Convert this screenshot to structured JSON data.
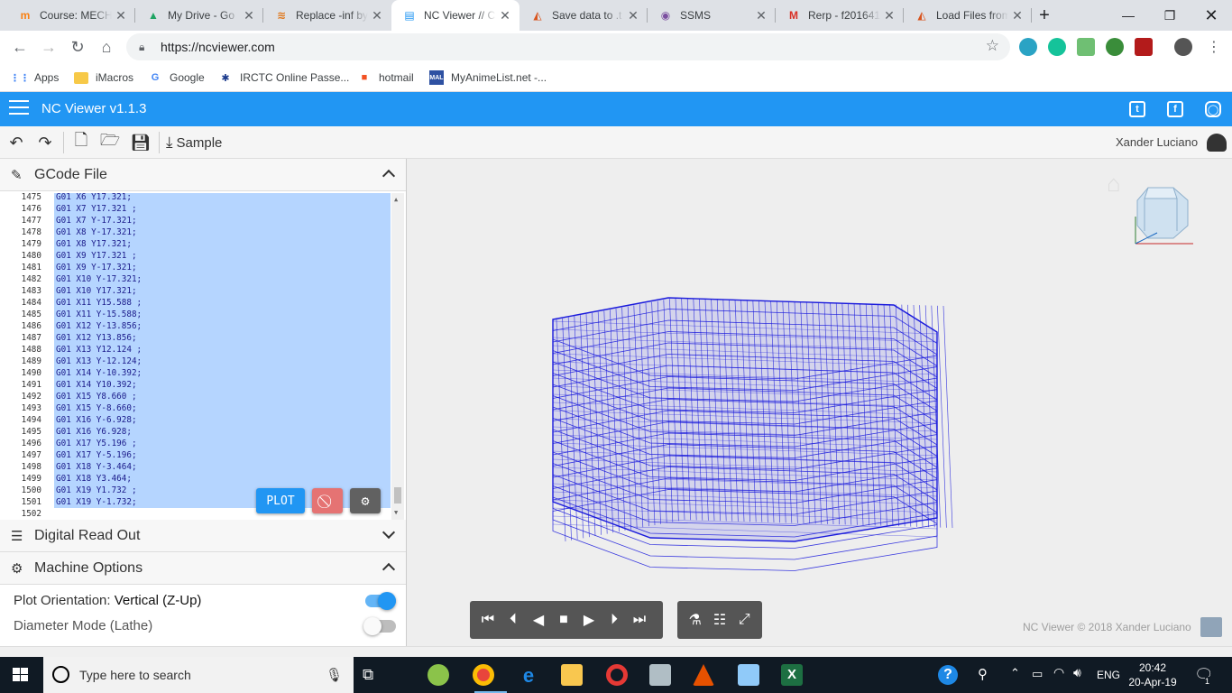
{
  "browser": {
    "tabs": [
      {
        "title": "Course: MECH",
        "favicon": "moodle-icon",
        "color": "#f98012",
        "glyph": "m"
      },
      {
        "title": "My Drive - Go",
        "favicon": "drive-icon",
        "color": "#1fa463",
        "glyph": "▲"
      },
      {
        "title": "Replace -inf by",
        "favicon": "stackexchange-icon",
        "color": "#e0781c",
        "glyph": "≋"
      },
      {
        "title": "NC Viewer // C",
        "favicon": "ncviewer-icon",
        "color": "#2196f3",
        "glyph": "▤"
      },
      {
        "title": "Save data to .t",
        "favicon": "matlab-icon",
        "color": "#d9541e",
        "glyph": "◭"
      },
      {
        "title": "SSMS",
        "favicon": "ssms-icon",
        "color": "#7b4fa0",
        "glyph": "◉"
      },
      {
        "title": "Rerp - f201641",
        "favicon": "gmail-icon",
        "color": "#d93025",
        "glyph": "M"
      },
      {
        "title": "Load Files from",
        "favicon": "matlab-icon",
        "color": "#d9541e",
        "glyph": "◭"
      }
    ],
    "active_tab": 3,
    "new_tab": "+",
    "url": "https://ncviewer.com",
    "bookmarks": [
      {
        "label": "Apps",
        "icon": "apps-grid-icon",
        "color": "#4285f4",
        "glyph": "⋮⋮"
      },
      {
        "label": "iMacros",
        "icon": "folder-icon",
        "color": "#f7c948",
        "glyph": ""
      },
      {
        "label": "Google",
        "icon": "google-icon",
        "color": "#4285f4",
        "glyph": "G"
      },
      {
        "label": "IRCTC Online Passe...",
        "icon": "irctc-icon",
        "color": "#1b3a8c",
        "glyph": "✱"
      },
      {
        "label": "hotmail",
        "icon": "microsoft-icon",
        "color": "#f25022",
        "glyph": "■"
      },
      {
        "label": "MyAnimeList.net -...",
        "icon": "mal-icon",
        "color": "#2e51a2",
        "glyph": "MAL"
      }
    ]
  },
  "app": {
    "title": "NC Viewer  v1.1.3",
    "sample_label": "Sample",
    "user_name": "Xander Luciano",
    "gcode_header": "GCode File",
    "gcode_lines": [
      {
        "n": "1475",
        "code": "G01 X6 Y17.321;"
      },
      {
        "n": "1476",
        "code": "G01 X7 Y17.321 ;"
      },
      {
        "n": "1477",
        "code": "G01 X7 Y-17.321;"
      },
      {
        "n": "1478",
        "code": "G01 X8 Y-17.321;"
      },
      {
        "n": "1479",
        "code": "G01 X8 Y17.321;"
      },
      {
        "n": "1480",
        "code": "G01 X9 Y17.321 ;"
      },
      {
        "n": "1481",
        "code": "G01 X9 Y-17.321;"
      },
      {
        "n": "1482",
        "code": "G01 X10 Y-17.321;"
      },
      {
        "n": "1483",
        "code": "G01 X10 Y17.321;"
      },
      {
        "n": "1484",
        "code": "G01 X11 Y15.588 ;"
      },
      {
        "n": "1485",
        "code": "G01 X11 Y-15.588;"
      },
      {
        "n": "1486",
        "code": "G01 X12 Y-13.856;"
      },
      {
        "n": "1487",
        "code": "G01 X12 Y13.856;"
      },
      {
        "n": "1488",
        "code": "G01 X13 Y12.124 ;"
      },
      {
        "n": "1489",
        "code": "G01 X13 Y-12.124;"
      },
      {
        "n": "1490",
        "code": "G01 X14 Y-10.392;"
      },
      {
        "n": "1491",
        "code": "G01 X14 Y10.392;"
      },
      {
        "n": "1492",
        "code": "G01 X15 Y8.660 ;"
      },
      {
        "n": "1493",
        "code": "G01 X15 Y-8.660;"
      },
      {
        "n": "1494",
        "code": "G01 X16 Y-6.928;"
      },
      {
        "n": "1495",
        "code": "G01 X16 Y6.928;"
      },
      {
        "n": "1496",
        "code": "G01 X17 Y5.196 ;"
      },
      {
        "n": "1497",
        "code": "G01 X17 Y-5.196;"
      },
      {
        "n": "1498",
        "code": "G01 X18 Y-3.464;"
      },
      {
        "n": "1499",
        "code": "G01 X18 Y3.464;"
      },
      {
        "n": "1500",
        "code": "G01 X19 Y1.732 ;"
      },
      {
        "n": "1501",
        "code": "G01 X19 Y-1.732;"
      },
      {
        "n": "1502",
        "code": ""
      }
    ],
    "plot_label": "PLOT",
    "dro_header": "Digital Read Out",
    "machine_header": "Machine Options",
    "plot_orientation_label": "Plot Orientation:",
    "plot_orientation_value": "Vertical (Z-Up)",
    "plot_orientation_on": true,
    "diameter_mode_label": "Diameter Mode (Lathe)",
    "diameter_mode_on": false,
    "footer_credit": "NC Viewer © 2018 Xander Luciano",
    "accent": "#2196f3",
    "toolpath_color": "#1a1adc"
  },
  "taskbar": {
    "search_placeholder": "Type here to search",
    "language": "ENG",
    "time": "20:42",
    "date": "20-Apr-19",
    "notification_count": "1"
  }
}
